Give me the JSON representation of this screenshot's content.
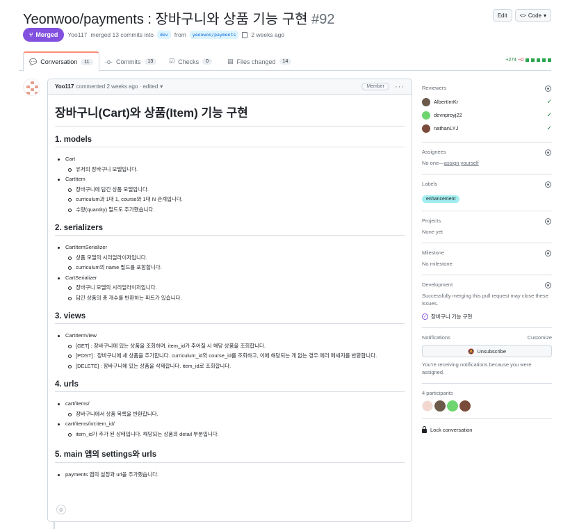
{
  "header": {
    "title": "Yeonwoo/payments : 장바구니와 상품 기능 구현",
    "number": "#92",
    "edit_label": "Edit",
    "code_label": "Code",
    "status": "Merged",
    "author": "Yoo117",
    "merge_text": "merged 13 commits into",
    "base_branch": "dev",
    "from_text": "from",
    "head_branch": "yeonwoo/payments",
    "time": "2 weeks ago"
  },
  "tabs": [
    {
      "label": "Conversation",
      "count": "11"
    },
    {
      "label": "Commits",
      "count": "13"
    },
    {
      "label": "Checks",
      "count": "0"
    },
    {
      "label": "Files changed",
      "count": "14"
    }
  ],
  "diffstat": {
    "additions": "+274",
    "deletions": "−0"
  },
  "comment": {
    "author": "Yoo117",
    "meta": "commented 2 weeks ago · edited",
    "role": "Member",
    "title": "장바구니(Cart)와 상품(Item) 기능 구현",
    "sections": [
      {
        "heading": "1. models",
        "items": [
          {
            "text": "Cart",
            "sub": [
              "유저의 장바구니 모델입니다."
            ]
          },
          {
            "text": "CartItem",
            "sub": [
              "장바구니에 담긴 상품 모델입니다.",
              "curriculum과 1대 1, course와 1대 N 관계입니다.",
              "수량(quantity) 필드도 추가했습니다."
            ]
          }
        ]
      },
      {
        "heading": "2. serializers",
        "items": [
          {
            "text": "CartItemSerializer",
            "sub": [
              "상품 모델의 시리얼라이저입니다.",
              "curriculum의 name 필드를 포함합니다."
            ]
          },
          {
            "text": "CartSerializer",
            "sub": [
              "장바구니 모델의 시리얼라이저입니다.",
              "담긴 상품의 총 개수를 반환하는 파트가 있습니다."
            ]
          }
        ]
      },
      {
        "heading": "3. views",
        "items": [
          {
            "text": "CartItemView",
            "sub": [
              "[GET] : 장바구니에 있는 상품을 조회하며, item_id가 주어질 시 해당 상품을 조회합니다.",
              "[POST] : 장바구니에 새 상품을 추가합니다. curriculum_id와 course_id를 조회하고, 이에 해당되는 게 없는 경우 에러 메세지를 반환합니다.",
              "[DELETE] : 장바구니에 있는 상품을 삭제합니다. item_id로 조회합니다."
            ]
          }
        ]
      },
      {
        "heading": "4. urls",
        "items": [
          {
            "text": "cart/items/",
            "sub": [
              "장바구니에서 상품 목록을 반환합니다."
            ]
          },
          {
            "text": "cart/items/int:item_id/",
            "sub": [
              "item_id가 추가 된 상태입니다. 해당되는 상품의 detail 부분입니다."
            ]
          }
        ]
      },
      {
        "heading": "5. main 앱의 settings와 urls",
        "items": [
          {
            "text": "payments 앱의 설정과 url을 추가했습니다.",
            "sub": []
          }
        ]
      }
    ]
  },
  "sidebar": {
    "reviewers_title": "Reviewers",
    "reviewers": [
      {
        "name": "AlbertImKr",
        "color": "#6b5a4a"
      },
      {
        "name": "devnproyj22",
        "color": "#6fd66f"
      },
      {
        "name": "nathanLYJ",
        "color": "#7a4b3a"
      }
    ],
    "assignees_title": "Assignees",
    "assignees_none": "No one—",
    "assign_yourself": "assign yourself",
    "labels_title": "Labels",
    "label": "enhancement",
    "projects_title": "Projects",
    "projects_none": "None yet",
    "milestone_title": "Milestone",
    "milestone_none": "No milestone",
    "development_title": "Development",
    "development_text": "Successfully merging this pull request may close these issues.",
    "linked_issue": "장바구니 기능 구현",
    "notifications_title": "Notifications",
    "customize": "Customize",
    "unsubscribe": "Unsubscribe",
    "notify_text": "You're receiving notifications because you were assigned.",
    "participants_title": "4 participants",
    "lock": "Lock conversation"
  }
}
